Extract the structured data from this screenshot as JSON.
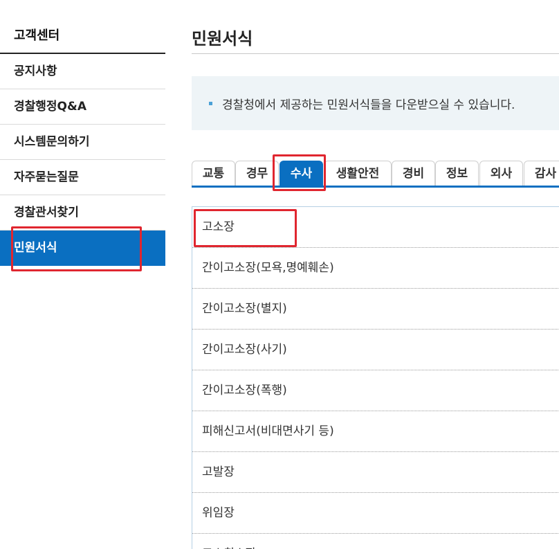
{
  "sidebar": {
    "title": "고객센터",
    "items": [
      {
        "label": "공지사항"
      },
      {
        "label": "경찰행정Q&A"
      },
      {
        "label": "시스템문의하기"
      },
      {
        "label": "자주묻는질문"
      },
      {
        "label": "경찰관서찾기"
      },
      {
        "label": "민원서식",
        "active": true
      }
    ]
  },
  "main": {
    "title": "민원서식",
    "info": "경찰청에서 제공하는 민원서식들을 다운받으실 수 있습니다.",
    "tabs": [
      {
        "label": "교통"
      },
      {
        "label": "경무"
      },
      {
        "label": "수사",
        "active": true
      },
      {
        "label": "생활안전"
      },
      {
        "label": "경비"
      },
      {
        "label": "정보"
      },
      {
        "label": "외사"
      },
      {
        "label": "감사"
      }
    ],
    "forms": [
      "고소장",
      "간이고소장(모욕,명예훼손)",
      "간이고소장(별지)",
      "간이고소장(사기)",
      "간이고소장(폭행)",
      "피해신고서(비대면사기 등)",
      "고발장",
      "위임장",
      "고소취소장"
    ]
  },
  "colors": {
    "accent": "#0a6fc1",
    "highlight": "#e0262f",
    "info_bg": "#eef4f7"
  }
}
